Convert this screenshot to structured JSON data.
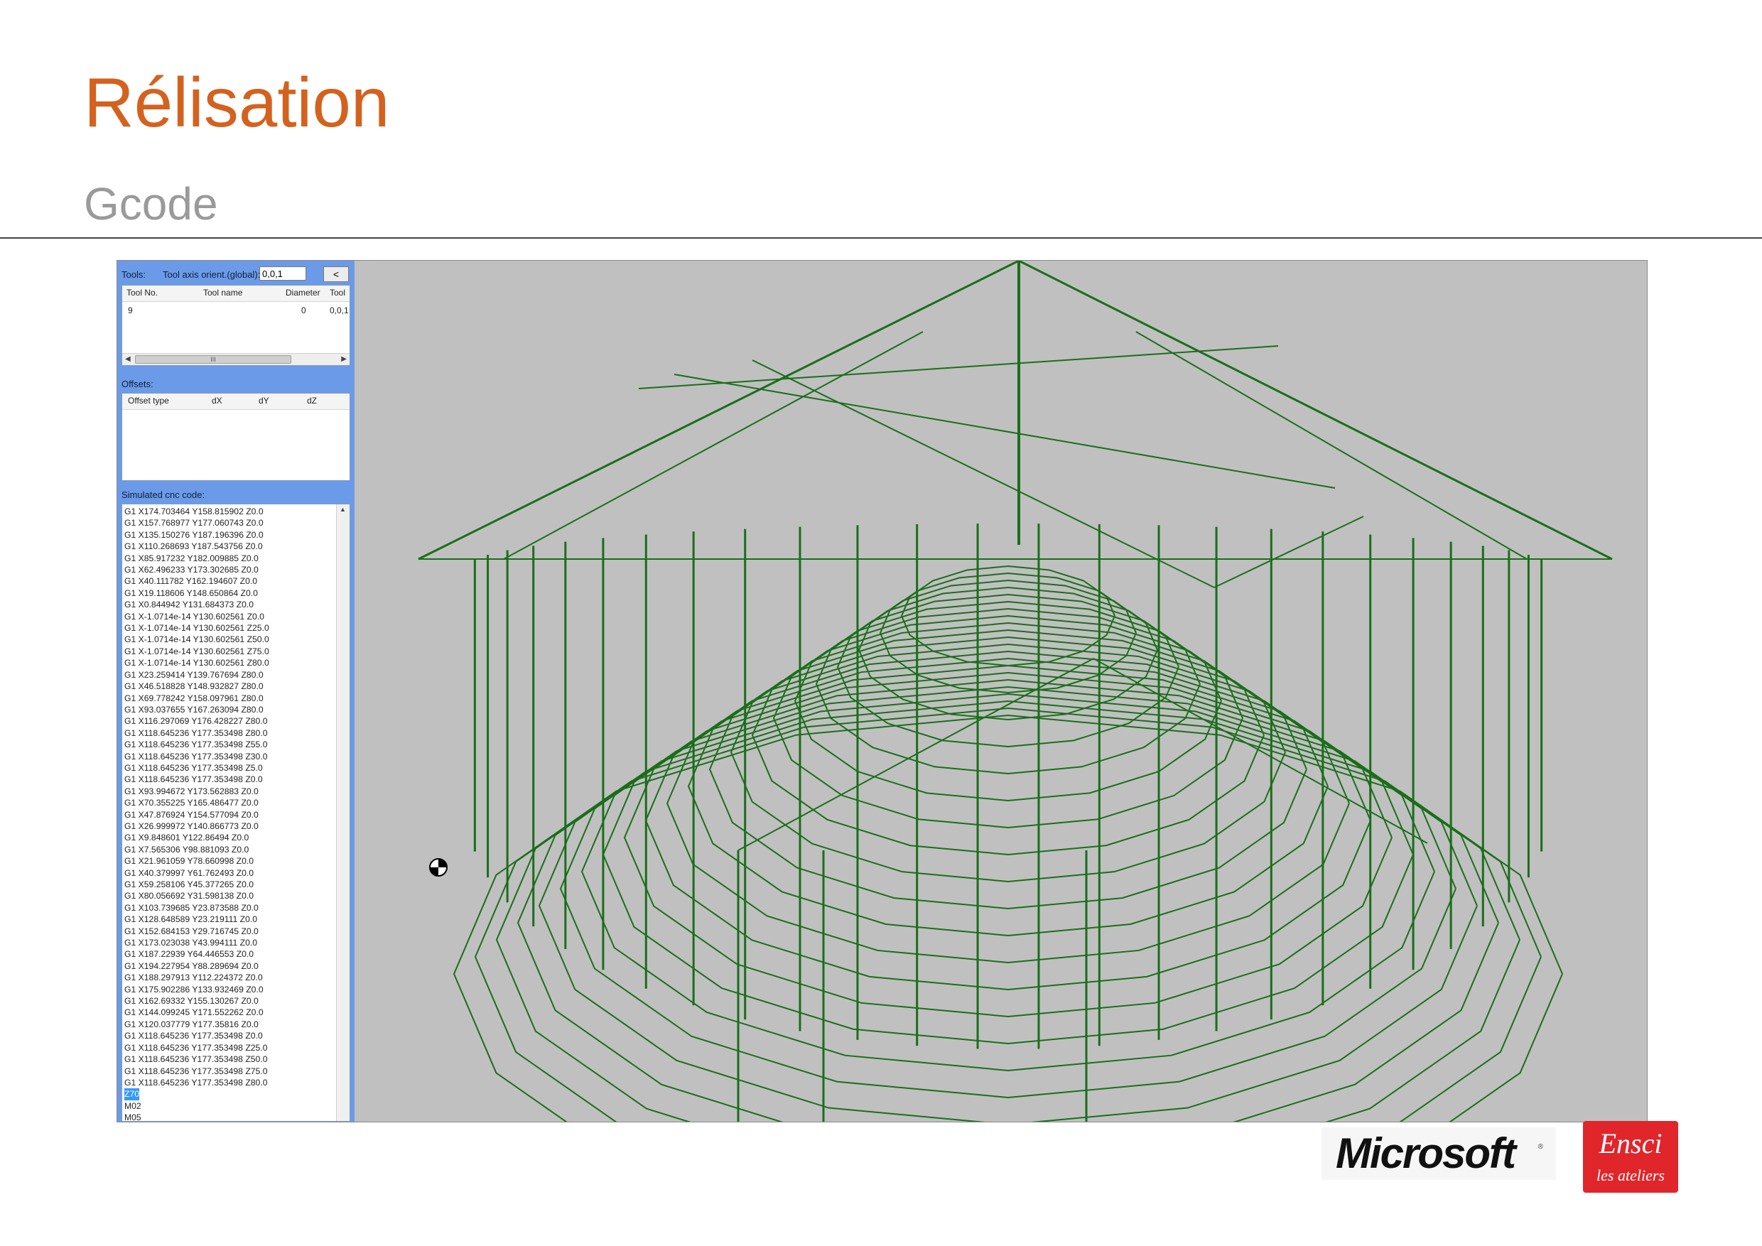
{
  "slide": {
    "title": "Rélisation",
    "subtitle": "Gcode"
  },
  "app": {
    "tools_label": "Tools:",
    "tool_axis_label": "Tool axis orient.(global):",
    "tool_axis_value": "0,0,1",
    "collapse_button": "<",
    "tools_table": {
      "headers": [
        "Tool No.",
        "Tool name",
        "Diameter",
        "Tool"
      ],
      "rows": [
        [
          "9",
          "",
          "0",
          "0,0,1"
        ]
      ],
      "scroll_thumb": "III"
    },
    "offsets_label": "Offsets:",
    "offsets_table": {
      "headers": [
        "Offset type",
        "dX",
        "dY",
        "dZ"
      ]
    },
    "code_label": "Simulated cnc code:",
    "code_lines": [
      "G1 X174.703464 Y158.815902 Z0.0",
      "G1 X157.768977 Y177.060743 Z0.0",
      "G1 X135.150276 Y187.196396 Z0.0",
      "G1 X110.268693 Y187.543756 Z0.0",
      "G1 X85.917232 Y182.009885 Z0.0",
      "G1 X62.496233 Y173.302685 Z0.0",
      "G1 X40.111782 Y162.194607 Z0.0",
      "G1 X19.118606 Y148.650864 Z0.0",
      "G1 X0.844942 Y131.684373 Z0.0",
      "G1 X-1.0714e-14 Y130.602561 Z0.0",
      "G1 X-1.0714e-14 Y130.602561 Z25.0",
      "G1 X-1.0714e-14 Y130.602561 Z50.0",
      "G1 X-1.0714e-14 Y130.602561 Z75.0",
      "G1 X-1.0714e-14 Y130.602561 Z80.0",
      "G1 X23.259414 Y139.767694 Z80.0",
      "G1 X46.518828 Y148.932827 Z80.0",
      "G1 X69.778242 Y158.097961 Z80.0",
      "G1 X93.037655 Y167.263094 Z80.0",
      "G1 X116.297069 Y176.428227 Z80.0",
      "G1 X118.645236 Y177.353498 Z80.0",
      "G1 X118.645236 Y177.353498 Z55.0",
      "G1 X118.645236 Y177.353498 Z30.0",
      "G1 X118.645236 Y177.353498 Z5.0",
      "G1 X118.645236 Y177.353498 Z0.0",
      "G1 X93.994672 Y173.562883 Z0.0",
      "G1 X70.355225 Y165.486477 Z0.0",
      "G1 X47.876924 Y154.577094 Z0.0",
      "G1 X26.999972 Y140.866773 Z0.0",
      "G1 X9.848601 Y122.86494 Z0.0",
      "G1 X7.565306 Y98.881093 Z0.0",
      "G1 X21.961059 Y78.660998 Z0.0",
      "G1 X40.379997 Y61.762493 Z0.0",
      "G1 X59.258106 Y45.377265 Z0.0",
      "G1 X80.056692 Y31.598138 Z0.0",
      "G1 X103.739685 Y23.873588 Z0.0",
      "G1 X128.648589 Y23.219111 Z0.0",
      "G1 X152.684153 Y29.716745 Z0.0",
      "G1 X173.023038 Y43.994111 Z0.0",
      "G1 X187.22939 Y64.446553 Z0.0",
      "G1 X194.227954 Y88.289694 Z0.0",
      "G1 X188.297913 Y112.224372 Z0.0",
      "G1 X175.902286 Y133.932469 Z0.0",
      "G1 X162.69332 Y155.130267 Z0.0",
      "G1 X144.099245 Y171.552262 Z0.0",
      "G1 X120.037779 Y177.35816 Z0.0",
      "G1 X118.645236 Y177.353498 Z0.0",
      "G1 X118.645236 Y177.353498 Z25.0",
      "G1 X118.645236 Y177.353498 Z50.0",
      "G1 X118.645236 Y177.353498 Z75.0",
      "G1 X118.645236 Y177.353498 Z80.0",
      "Z70",
      "M02",
      "M05"
    ],
    "selected_line": "Z70",
    "toolpath_color": "#1a6e1a"
  },
  "logos": {
    "microsoft": "Microsoft",
    "ensci_top": "Ensci",
    "ensci_bottom": "les ateliers"
  }
}
